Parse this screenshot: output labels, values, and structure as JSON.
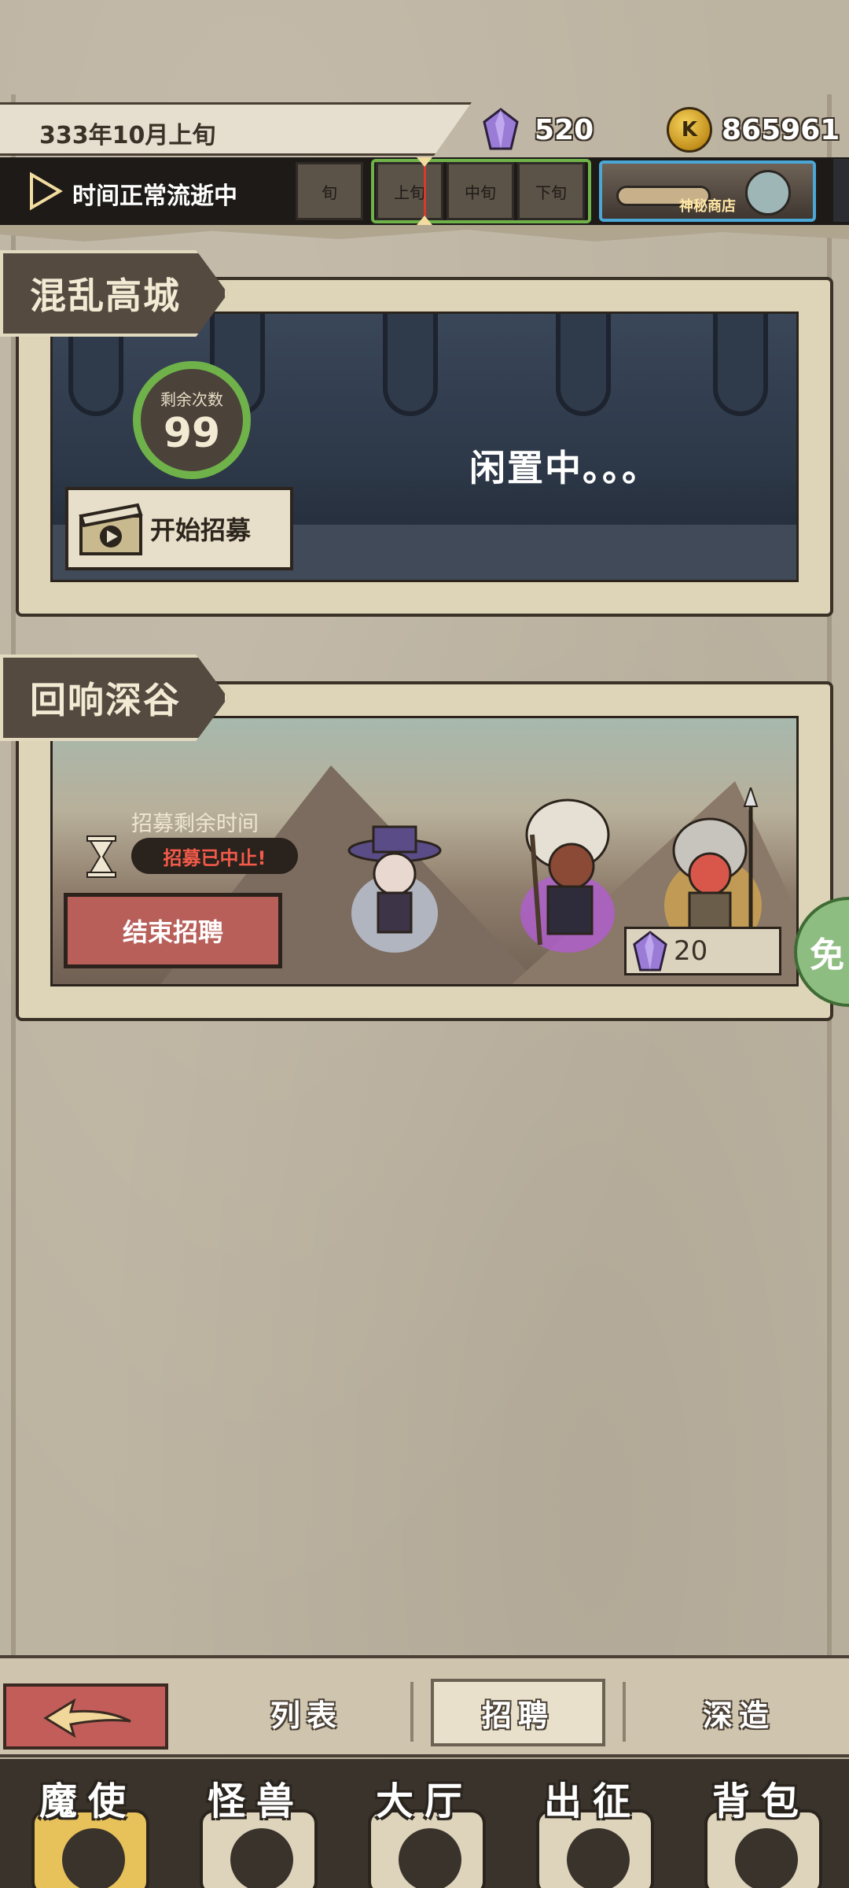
{
  "header": {
    "date": "333年10月上旬",
    "gems": "520",
    "coins": "865961",
    "coin_symbol": "K"
  },
  "time_bar": {
    "status": "时间正常流逝中",
    "prev_period": "旬",
    "periods": [
      "上旬",
      "中旬",
      "下旬"
    ],
    "shop_label": "神秘商店"
  },
  "cards": [
    {
      "title": "混乱高城",
      "remaining_label": "剩余次数",
      "remaining_value": "99",
      "status": "闲置中。。。",
      "action": "开始招募"
    },
    {
      "title": "回响深谷",
      "time_label": "招募剩余时间",
      "time_status": "招募已中止!",
      "action": "结束招聘",
      "cost": "20",
      "free_badge": "免"
    }
  ],
  "subnav": {
    "tabs": [
      "列表",
      "招聘",
      "深造"
    ],
    "active": "招聘"
  },
  "bottom_menu": [
    {
      "label": "魔使",
      "icon": "demon-envoy-icon"
    },
    {
      "label": "怪兽",
      "icon": "monster-icon"
    },
    {
      "label": "大厅",
      "icon": "hall-icon"
    },
    {
      "label": "出征",
      "icon": "expedition-icon"
    },
    {
      "label": "背包",
      "icon": "backpack-icon"
    }
  ],
  "colors": {
    "progress_green": "#6fb24a",
    "shop_blue": "#4aa7d6",
    "danger_red": "#b85f5a",
    "stopped_text": "#f25a4a"
  }
}
